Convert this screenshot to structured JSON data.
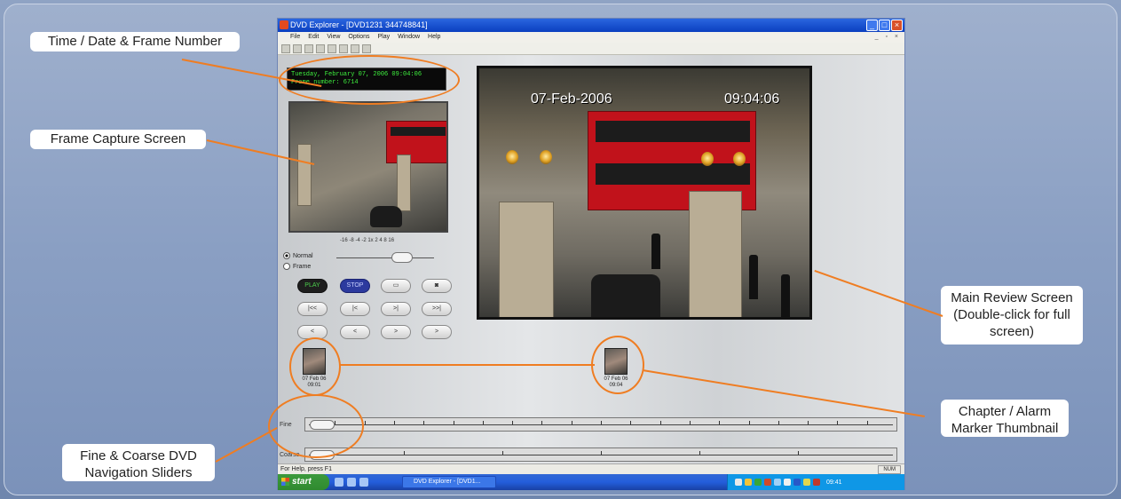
{
  "callouts": {
    "time_date": "Time / Date & Frame Number",
    "frame_capture": "Frame Capture Screen",
    "main_review_line1": "Main Review Screen",
    "main_review_line2": "(Double-click for full",
    "main_review_line3": "screen)",
    "chapter_line1": "Chapter / Alarm",
    "chapter_line2": "Marker Thumbnail",
    "nav_line1": "Fine & Coarse DVD",
    "nav_line2": "Navigation Sliders"
  },
  "window": {
    "title": "DVD Explorer - [DVD1231 344748841]",
    "menu": [
      "File",
      "Edit",
      "View",
      "Options",
      "Play",
      "Window",
      "Help"
    ]
  },
  "infobox": {
    "line1": "Tuesday, February 07, 2006 09:04:06",
    "line2": "Frame number: 6714"
  },
  "main_overlay": {
    "date": "07-Feb-2006",
    "time": "09:04:06"
  },
  "controls": {
    "speed_scale": "-16 -8 -4 -2 1x 2 4 8 16",
    "normal_label": "Normal",
    "frame_label": "Frame",
    "buttons_row1": [
      "PLAY",
      "STOP",
      "",
      ""
    ],
    "buttons_row2": [
      "|<<",
      "|<",
      ">|",
      ">>|"
    ],
    "buttons_row3": [
      "<",
      "<",
      ">",
      ">"
    ]
  },
  "markers": [
    {
      "caption_line1": "07 Feb 06",
      "caption_line2": "09:01"
    },
    {
      "caption_line1": "07 Feb 06",
      "caption_line2": "09:04"
    }
  ],
  "navigation": {
    "fine_label": "Fine",
    "coarse_label": "Coarse"
  },
  "statusbar": {
    "help_text": "For Help, press F1",
    "num_indicator": "NUM"
  },
  "taskbar": {
    "start_label": "start",
    "task_item": "DVD Explorer - [DVD1...",
    "clock": "09:41"
  },
  "colors": {
    "accent_orange": "#ef7d22",
    "titlebar_blue": "#0b3fbf",
    "osd_green": "#3ef03e"
  }
}
